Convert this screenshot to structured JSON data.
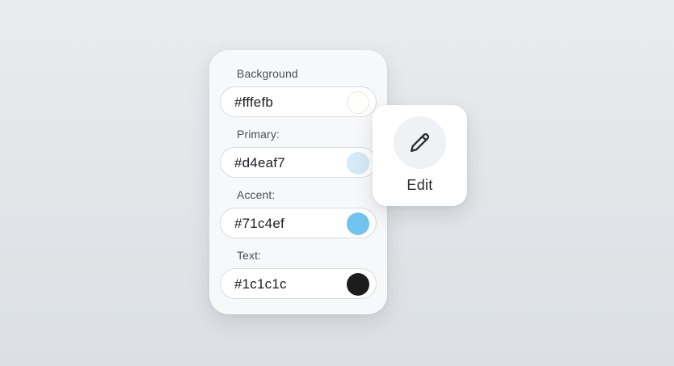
{
  "theme_editor": {
    "fields": [
      {
        "label": "Background",
        "value": "#fffefb",
        "swatch_color": "#fffefb"
      },
      {
        "label": "Primary:",
        "value": "#d4eaf7",
        "swatch_color": "#d4eaf7"
      },
      {
        "label": "Accent:",
        "value": "#71c4ef",
        "swatch_color": "#71c4ef"
      },
      {
        "label": "Text:",
        "value": "#1c1c1c",
        "swatch_color": "#1c1c1c"
      }
    ]
  },
  "edit_button": {
    "label": "Edit",
    "icon": "pencil-icon"
  }
}
